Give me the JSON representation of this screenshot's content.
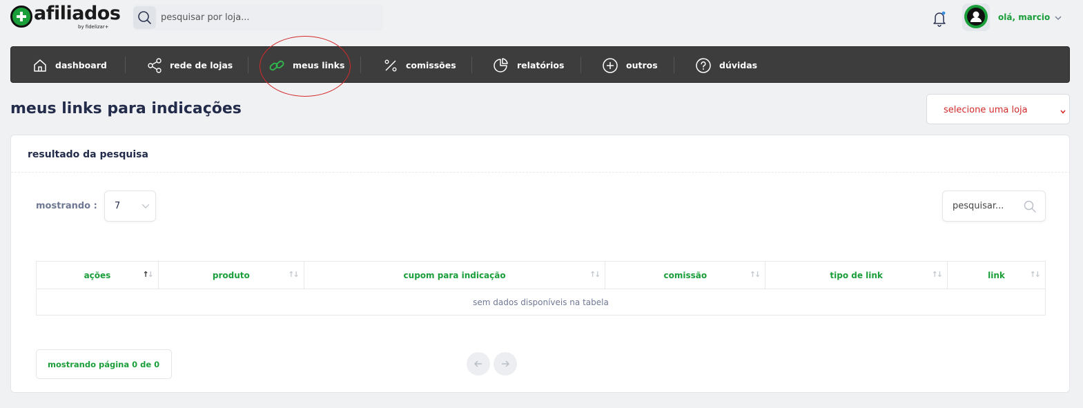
{
  "header": {
    "logo_text": "afiliados",
    "logo_sub": "by fidelizar+",
    "search_placeholder": "pesquisar por loja...",
    "user_greeting": "olá, marcio"
  },
  "nav": {
    "items": [
      {
        "label": "dashboard",
        "icon": "home-icon"
      },
      {
        "label": "rede de lojas",
        "icon": "share-icon"
      },
      {
        "label": "meus links",
        "icon": "link-icon"
      },
      {
        "label": "comissões",
        "icon": "percent-icon"
      },
      {
        "label": "relatórios",
        "icon": "pie-chart-icon"
      },
      {
        "label": "outros",
        "icon": "plus-circle-icon"
      },
      {
        "label": "dúvidas",
        "icon": "help-circle-icon"
      }
    ],
    "highlighted_item": "meus links",
    "highlight_color": "#d32a2a"
  },
  "page": {
    "title": "meus links para indicações",
    "store_select": "selecione uma loja"
  },
  "results": {
    "card_title": "resultado da pesquisa",
    "show_label": "mostrando :",
    "page_size": "7",
    "table_search_placeholder": "pesquisar...",
    "columns": [
      "ações",
      "produto",
      "cupom para indicação",
      "comissão",
      "tipo de link",
      "link"
    ],
    "empty_message": "sem dados disponíveis na tabela",
    "page_info": "mostrando página 0 de 0"
  },
  "colors": {
    "accent_green": "#1a9e3a",
    "nav_bg": "#3d3d3d",
    "warning_red": "#d32a2a"
  }
}
